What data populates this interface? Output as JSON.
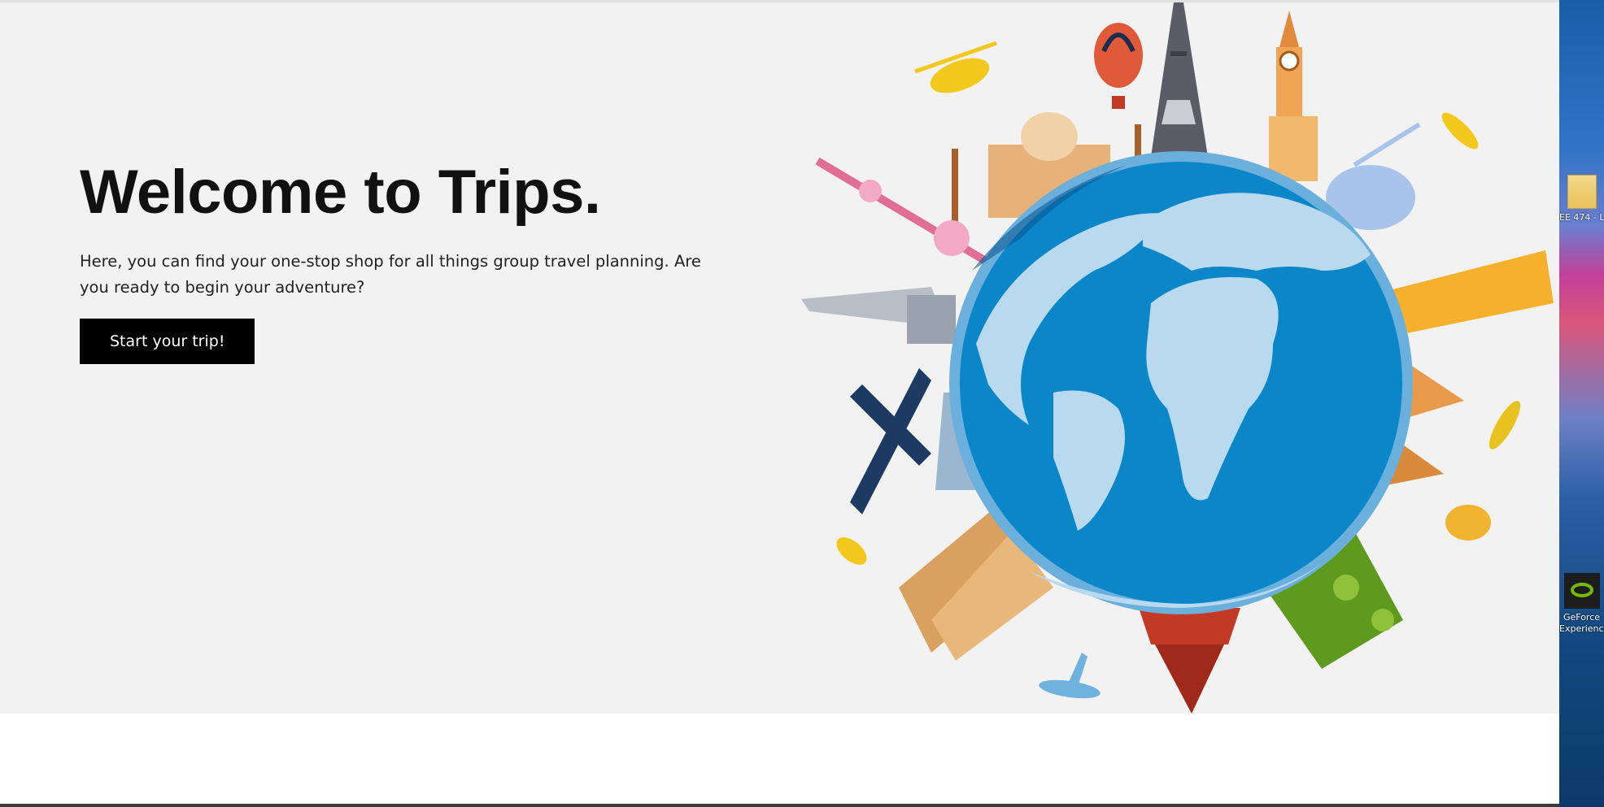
{
  "hero": {
    "title": "Welcome to Trips.",
    "description": "Here, you can find your one-stop shop for all things group travel planning. Are you ready to begin your adventure?",
    "cta_label": "Start your trip!"
  },
  "desktop": {
    "icons": [
      {
        "label": "EE 474 - L",
        "icon": "folder-icon"
      },
      {
        "label": "GeForce Experience",
        "icon": "geforce-icon"
      }
    ]
  },
  "colors": {
    "hero_bg": "#f2f2f2",
    "button_bg": "#000000",
    "ocean": "#0a86c9",
    "land": "#b9d9ef"
  }
}
